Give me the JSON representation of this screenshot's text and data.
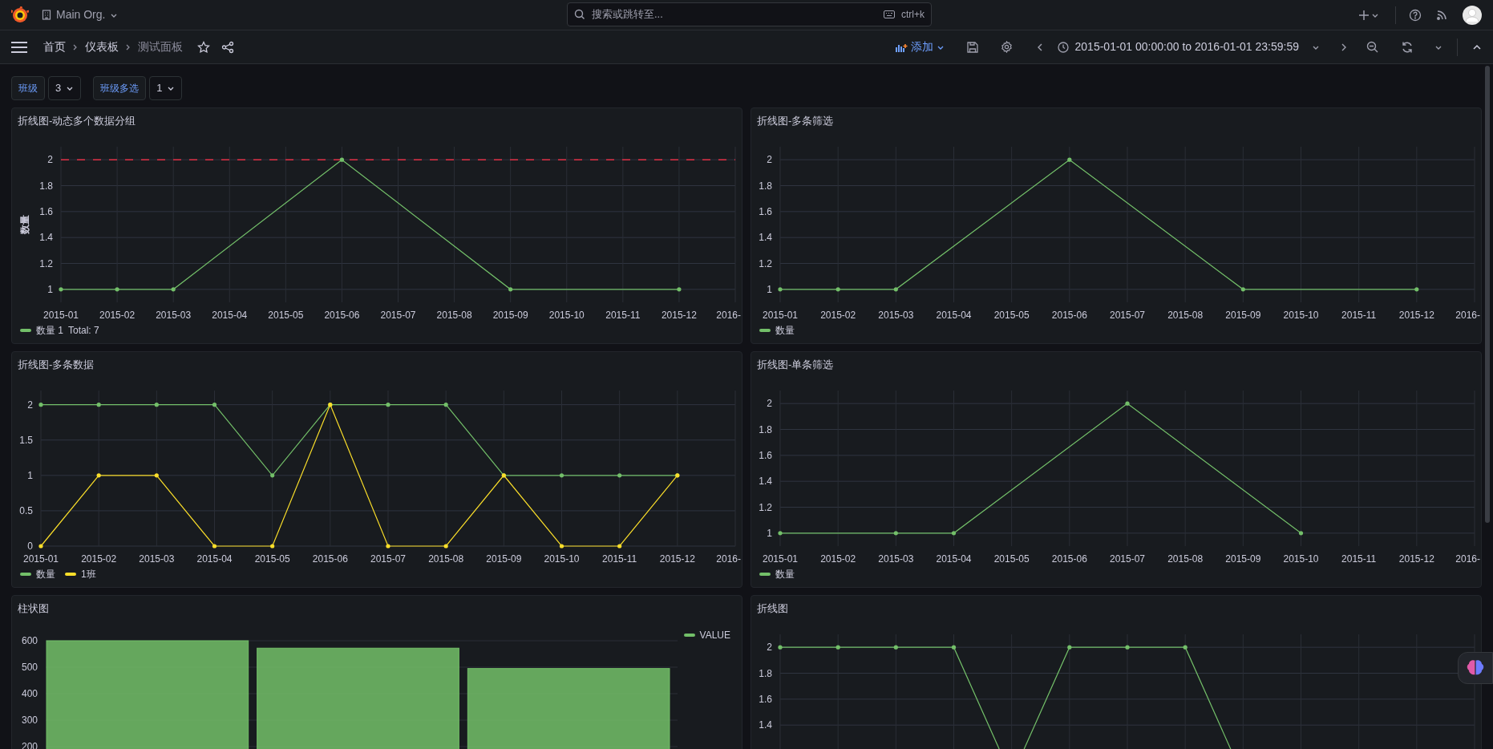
{
  "top_bar": {
    "org": "Main Org.",
    "search": {
      "placeholder": "搜索或跳转至..."
    },
    "shortcut": "ctrl+k"
  },
  "toolbar": {
    "breadcrumbs": [
      {
        "label": "首页",
        "selected": false
      },
      {
        "label": "仪表板",
        "selected": false
      },
      {
        "label": "测试面板",
        "selected": true
      }
    ],
    "add_button": "添加",
    "time_range": "2015-01-01 00:00:00 to 2016-01-01 23:59:59"
  },
  "variables": [
    {
      "label": "班级",
      "value": "3"
    },
    {
      "label": "班级多选",
      "value": "1"
    }
  ],
  "panels": [
    {
      "title": "折线图-动态多个数据分组",
      "legend_total": "Total: 7",
      "chart_data": {
        "type": "line",
        "ylabel": "数量",
        "categories": [
          "2015-01",
          "2015-02",
          "2015-03",
          "2015-04",
          "2015-05",
          "2015-06",
          "2015-07",
          "2015-08",
          "2015-09",
          "2015-10",
          "2015-11",
          "2015-12",
          "2016-"
        ],
        "ylim": [
          0.9,
          2.1
        ],
        "yticks": [
          1,
          1.2,
          1.4,
          1.6,
          1.8,
          2
        ],
        "grid": true,
        "ref_lines": [
          {
            "axis": "y",
            "value": 2,
            "color": "#e02f44"
          }
        ],
        "series": [
          {
            "name": "数量 1",
            "color": "#73bf69",
            "values": [
              1,
              1,
              1,
              null,
              null,
              2,
              null,
              null,
              1,
              null,
              null,
              1,
              null
            ]
          }
        ]
      }
    },
    {
      "title": "折线图-多条筛选",
      "chart_data": {
        "type": "line",
        "categories": [
          "2015-01",
          "2015-02",
          "2015-03",
          "2015-04",
          "2015-05",
          "2015-06",
          "2015-07",
          "2015-08",
          "2015-09",
          "2015-10",
          "2015-11",
          "2015-12",
          "2016-"
        ],
        "ylim": [
          0.9,
          2.1
        ],
        "yticks": [
          1,
          1.2,
          1.4,
          1.6,
          1.8,
          2
        ],
        "grid": true,
        "series": [
          {
            "name": "数量",
            "color": "#73bf69",
            "values": [
              1,
              1,
              1,
              null,
              null,
              2,
              null,
              null,
              1,
              null,
              null,
              1,
              null
            ]
          }
        ]
      }
    },
    {
      "title": "折线图-多条数据",
      "chart_data": {
        "type": "line",
        "categories": [
          "2015-01",
          "2015-02",
          "2015-03",
          "2015-04",
          "2015-05",
          "2015-06",
          "2015-07",
          "2015-08",
          "2015-09",
          "2015-10",
          "2015-11",
          "2015-12",
          "2016-"
        ],
        "ylim": [
          0,
          2.2
        ],
        "yticks": [
          0,
          0.5,
          1,
          1.5,
          2
        ],
        "grid": true,
        "series": [
          {
            "name": "数量",
            "color": "#73bf69",
            "values": [
              2,
              2,
              2,
              2,
              1,
              2,
              2,
              2,
              1,
              1,
              1,
              1,
              null
            ]
          },
          {
            "name": "1班",
            "color": "#fade2a",
            "values": [
              0,
              1,
              1,
              0,
              0,
              2,
              0,
              0,
              1,
              0,
              0,
              1,
              null
            ]
          }
        ]
      }
    },
    {
      "title": "折线图-单条筛选",
      "chart_data": {
        "type": "line",
        "categories": [
          "2015-01",
          "2015-02",
          "2015-03",
          "2015-04",
          "2015-05",
          "2015-06",
          "2015-07",
          "2015-08",
          "2015-09",
          "2015-10",
          "2015-11",
          "2015-12",
          "2016-"
        ],
        "ylim": [
          0.9,
          2.1
        ],
        "yticks": [
          1,
          1.2,
          1.4,
          1.6,
          1.8,
          2
        ],
        "grid": true,
        "series": [
          {
            "name": "数量",
            "color": "#73bf69",
            "values": [
              1,
              null,
              1,
              1,
              null,
              null,
              2,
              null,
              null,
              1,
              null,
              null,
              null
            ]
          }
        ]
      }
    },
    {
      "title": "柱状图",
      "chart_data": {
        "type": "bar",
        "ylim": [
          0,
          600
        ],
        "yticks": [
          200,
          300,
          400,
          500,
          600
        ],
        "grid": true,
        "series": [
          {
            "name": "VALUE",
            "color": "#73bf69",
            "values": [
              600,
              572,
              495
            ]
          }
        ]
      }
    },
    {
      "title": "折线图",
      "chart_data": {
        "type": "line",
        "categories": [
          null,
          null,
          null,
          null,
          null,
          null,
          null,
          null,
          null,
          null,
          null,
          null,
          null
        ],
        "ylim": [
          0.9,
          2.1
        ],
        "yticks": [
          1.4,
          1.6,
          1.8,
          2
        ],
        "grid": true,
        "series": [
          {
            "color": "#73bf69",
            "values": [
              2,
              2,
              2,
              2,
              1,
              2,
              2,
              2,
              1,
              null,
              null,
              null,
              null
            ]
          }
        ]
      }
    }
  ]
}
